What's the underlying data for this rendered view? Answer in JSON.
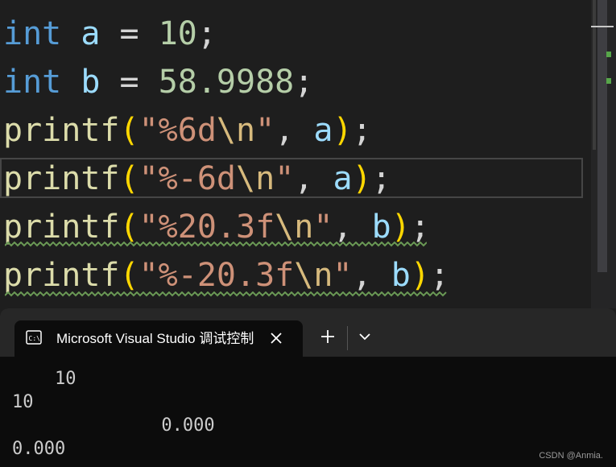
{
  "editor": {
    "lines": [
      {
        "id": "line-int-a",
        "tokens": [
          {
            "t": "int",
            "c": "kw"
          },
          {
            "t": " ",
            "c": "op"
          },
          {
            "t": "a",
            "c": "var"
          },
          {
            "t": " = ",
            "c": "op"
          },
          {
            "t": "10",
            "c": "num"
          },
          {
            "t": ";",
            "c": "pun"
          }
        ]
      },
      {
        "id": "line-int-b",
        "tokens": [
          {
            "t": "int",
            "c": "kw"
          },
          {
            "t": " ",
            "c": "op"
          },
          {
            "t": "b",
            "c": "var"
          },
          {
            "t": " = ",
            "c": "op"
          },
          {
            "t": "58.9988",
            "c": "num"
          },
          {
            "t": ";",
            "c": "pun"
          }
        ]
      },
      {
        "id": "line-printf-6d",
        "tokens": [
          {
            "t": "printf",
            "c": "fn"
          },
          {
            "t": "(",
            "c": "par"
          },
          {
            "t": "\"%6d",
            "c": "str"
          },
          {
            "t": "\\n",
            "c": "esc"
          },
          {
            "t": "\"",
            "c": "str"
          },
          {
            "t": ", ",
            "c": "pun"
          },
          {
            "t": "a",
            "c": "var"
          },
          {
            "t": ")",
            "c": "par"
          },
          {
            "t": ";",
            "c": "pun"
          }
        ]
      },
      {
        "id": "line-printf-minus6d",
        "tokens": [
          {
            "t": "printf",
            "c": "fn"
          },
          {
            "t": "(",
            "c": "par"
          },
          {
            "t": "\"%-6d",
            "c": "str"
          },
          {
            "t": "\\n",
            "c": "esc"
          },
          {
            "t": "\"",
            "c": "str"
          },
          {
            "t": ", ",
            "c": "pun"
          },
          {
            "t": "a",
            "c": "var"
          },
          {
            "t": ")",
            "c": "par"
          },
          {
            "t": ";",
            "c": "pun"
          }
        ]
      },
      {
        "id": "line-printf-20-3f",
        "tokens": [
          {
            "t": "printf",
            "c": "fn"
          },
          {
            "t": "(",
            "c": "par"
          },
          {
            "t": "\"%20.3f",
            "c": "str"
          },
          {
            "t": "\\n",
            "c": "esc"
          },
          {
            "t": "\"",
            "c": "str"
          },
          {
            "t": ", ",
            "c": "pun"
          },
          {
            "t": "b",
            "c": "var"
          },
          {
            "t": ")",
            "c": "par"
          },
          {
            "t": ";",
            "c": "pun"
          }
        ]
      },
      {
        "id": "line-printf-minus20-3f",
        "tokens": [
          {
            "t": "printf",
            "c": "fn"
          },
          {
            "t": "(",
            "c": "par"
          },
          {
            "t": "\"%-20.3f",
            "c": "str"
          },
          {
            "t": "\\n",
            "c": "esc"
          },
          {
            "t": "\"",
            "c": "str"
          },
          {
            "t": ", ",
            "c": "pun"
          },
          {
            "t": "b",
            "c": "var"
          },
          {
            "t": ")",
            "c": "par"
          },
          {
            "t": ";",
            "c": "pun"
          }
        ]
      }
    ],
    "warning_color": "#6a9955"
  },
  "terminal": {
    "tab_title": "Microsoft Visual Studio 调试控制台",
    "tab_icon": "console-icon",
    "close_icon": "close-icon",
    "new_tab_icon": "plus-icon",
    "dropdown_icon": "chevron-down-icon",
    "output": [
      "    10",
      "10",
      "              0.000",
      "0.000"
    ]
  },
  "watermark": "CSDN @Anmia."
}
